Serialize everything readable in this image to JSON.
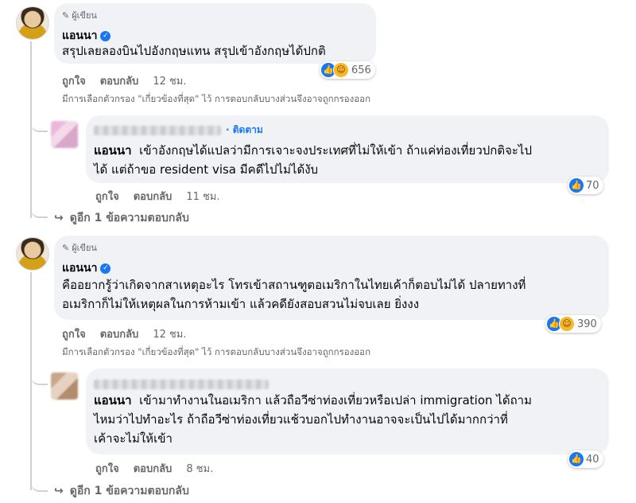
{
  "comment1": {
    "badge": "ผู้เขียน",
    "author": "แอนนา",
    "text": "สรุปเลยลองบินไปอังกฤษแทน สรุปเข้าอังกฤษได้ปกติ",
    "like_label": "ถูกใจ",
    "reply_label": "ตอบกลับ",
    "time": "12 ชม.",
    "reaction_count": "656"
  },
  "filter_note": "มีการเลือกตัวกรอง \"เกี่ยวข้องที่สุด\" ไว้ การตอบกลับบางส่วนจึงอาจถูกกรองออก",
  "reply1": {
    "follow_label": "· ติดตาม",
    "mention": "แอนนา",
    "text": "เข้าอังกฤษได้แปลว่ามีการเจาะจงประเทศที่ไม่ให้เข้า ถ้าแค่ท่องเที่ยวปกติจะไปได้ แต่ถ้าขอ resident visa มีคดีไปไม่ได้งับ",
    "line1": "เข้าอังกฤษได้แปลว่ามีการเจาะจงประเทศที่ไม่ให้เข้า ถ้าแค่ท่องเที่ยวปกติจะไป",
    "line2": "ได้ แต่ถ้าขอ resident visa มีคดีไปไม่ได้งับ",
    "like_label": "ถูกใจ",
    "reply_label": "ตอบกลับ",
    "time": "11 ชม.",
    "reaction_count": "70"
  },
  "more1": "ดูอีก 1 ข้อความตอบกลับ",
  "comment2": {
    "badge": "ผู้เขียน",
    "author": "แอนนา",
    "line1": "คืออยากรู้ว่าเกิดจากสาเหตุอะไร โทรเข้าสถานฑูตอเมริกาในไทยเค้าก็ตอบไม่ได้ ปลายทางที่",
    "line2": "อเมริกาก็ไม่ให้เหตุผลในการห้ามเข้า แล้วคดียังสอบสวนไม่จบเลย ยิ่งงง",
    "like_label": "ถูกใจ",
    "reply_label": "ตอบกลับ",
    "time": "12 ชม.",
    "reaction_count": "390"
  },
  "reply2": {
    "mention": "แอนนา",
    "line1": "เข้ามาทำงานในอเมริกา แล้วถือวีซ่าท่องเที่ยวหรือเปล่า immigration ได้ถาม",
    "line2": "ไหมว่าไปทำอะไร ถ้าถือวีซ่าท่องเที่ยวแช้วบอกไปทำงานอาจจะเป็นไปได้มากกว่าที่",
    "line3": "เค้าจะไม่ให้เข้า",
    "like_label": "ถูกใจ",
    "reply_label": "ตอบกลับ",
    "time": "8 ชม.",
    "reaction_count": "40"
  },
  "more2": "ดูอีก 1 ข้อความตอบกลับ"
}
